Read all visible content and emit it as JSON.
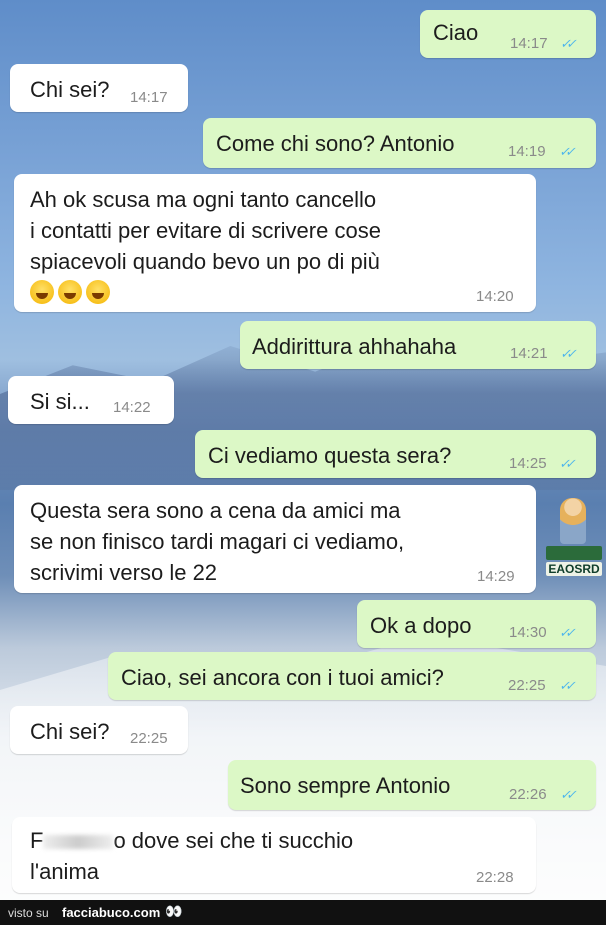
{
  "messages": [
    {
      "dir": "out",
      "text": "Ciao",
      "time": "14:17"
    },
    {
      "dir": "in",
      "text": "Chi sei?",
      "time": "14:17"
    },
    {
      "dir": "out",
      "text": "Come chi sono? Antonio",
      "time": "14:19"
    },
    {
      "dir": "in",
      "text": "Ah ok scusa ma ogni tanto cancello\ni contatti per evitare di scrivere cose\nspiacevoli quando bevo un po di più",
      "time": "14:20",
      "emoji": "😂😂😂"
    },
    {
      "dir": "out",
      "text": "Addirittura ahhahaha",
      "time": "14:21"
    },
    {
      "dir": "in",
      "text": "Si si...",
      "time": "14:22"
    },
    {
      "dir": "out",
      "text": "Ci vediamo questa sera?",
      "time": "14:25"
    },
    {
      "dir": "in",
      "text": "Questa sera sono a cena da amici ma\nse non finisco tardi magari ci vediamo,\nscrivimi verso le 22",
      "time": "14:29"
    },
    {
      "dir": "out",
      "text": "Ok a dopo",
      "time": "14:30"
    },
    {
      "dir": "out",
      "text": "Ciao, sei ancora con i tuoi amici?",
      "time": "22:25"
    },
    {
      "dir": "in",
      "text": "Chi sei?",
      "time": "22:25"
    },
    {
      "dir": "out",
      "text": "Sono sempre Antonio",
      "time": "22:26"
    },
    {
      "dir": "in",
      "text_start": "F",
      "text_end": "o dove sei che ti succhio\nl'anima",
      "time": "22:28"
    }
  ],
  "read_ticks": "✓✓",
  "watermark": {
    "brand": "EAOSRD"
  },
  "footer": {
    "visto": "visto su",
    "site": "facciabuco.com",
    "eyes": "👀"
  },
  "colors": {
    "incoming": "#ffffff",
    "outgoing": "#dcf8c6",
    "ticks": "#4fb6ec",
    "footer": "#111111"
  }
}
